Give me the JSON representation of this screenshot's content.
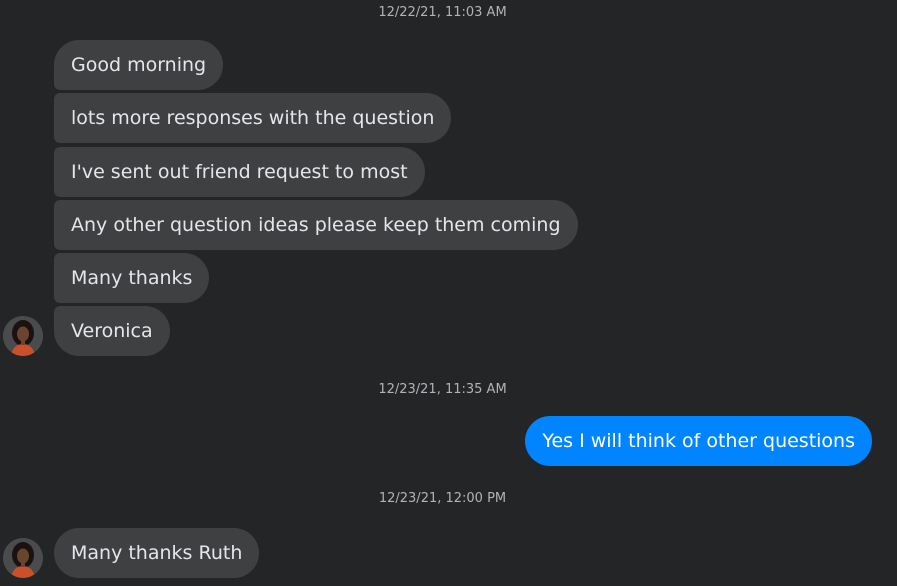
{
  "conversation": {
    "sections": [
      {
        "timestamp": "12/22/21, 11:03 AM",
        "messages": [
          {
            "sender": "contact",
            "text": "Good morning"
          },
          {
            "sender": "contact",
            "text": "lots more responses with the question"
          },
          {
            "sender": "contact",
            "text": "I've sent out friend request to most"
          },
          {
            "sender": "contact",
            "text": "Any other question ideas please keep them coming"
          },
          {
            "sender": "contact",
            "text": "Many thanks"
          },
          {
            "sender": "contact",
            "text": "Veronica"
          }
        ]
      },
      {
        "timestamp": "12/23/21, 11:35 AM",
        "messages": [
          {
            "sender": "me",
            "text": "Yes I will think of other questions"
          }
        ]
      },
      {
        "timestamp": "12/23/21, 12:00 PM",
        "messages": [
          {
            "sender": "contact",
            "text": "Many thanks Ruth"
          }
        ]
      }
    ]
  },
  "colors": {
    "background": "#242526",
    "incoming_bubble": "#3e4042",
    "outgoing_bubble": "#0084ff",
    "text_primary": "#e4e6eb",
    "timestamp_text": "#b0b3b8"
  },
  "icons": {
    "contact_avatar": "avatar-photo-icon"
  }
}
